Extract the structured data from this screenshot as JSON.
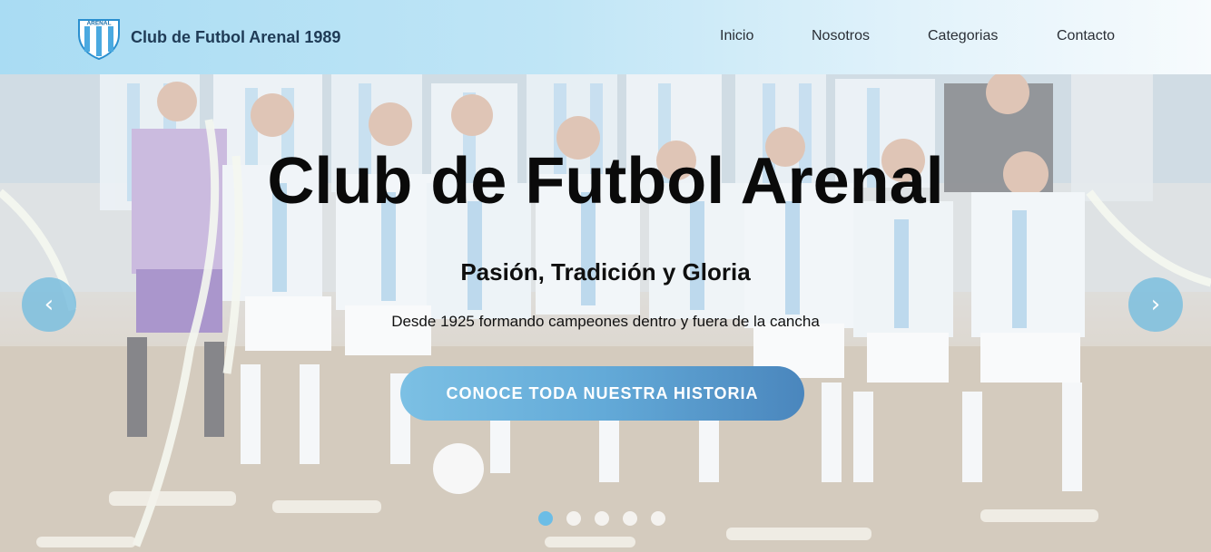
{
  "header": {
    "brand_name": "Club de Futbol Arenal 1989",
    "logo_text": "ARENAL",
    "nav": [
      {
        "label": "Inicio"
      },
      {
        "label": "Nosotros"
      },
      {
        "label": "Categorias"
      },
      {
        "label": "Contacto"
      }
    ]
  },
  "hero": {
    "title": "Club de Futbol Arenal",
    "subtitle": "Pasión, Tradición y Gloria",
    "text": "Desde 1925 formando campeones dentro y fuera de la cancha",
    "cta_label": "CONOCE TODA NUESTRA HISTORIA",
    "prev_arrow": "‹",
    "next_arrow": "›",
    "slides_count": 5,
    "active_slide": 1
  },
  "colors": {
    "accent": "#6cbde6",
    "cta_start": "#7cc0e4",
    "cta_end": "#4a86bd",
    "header_start": "#a9dcf3"
  }
}
